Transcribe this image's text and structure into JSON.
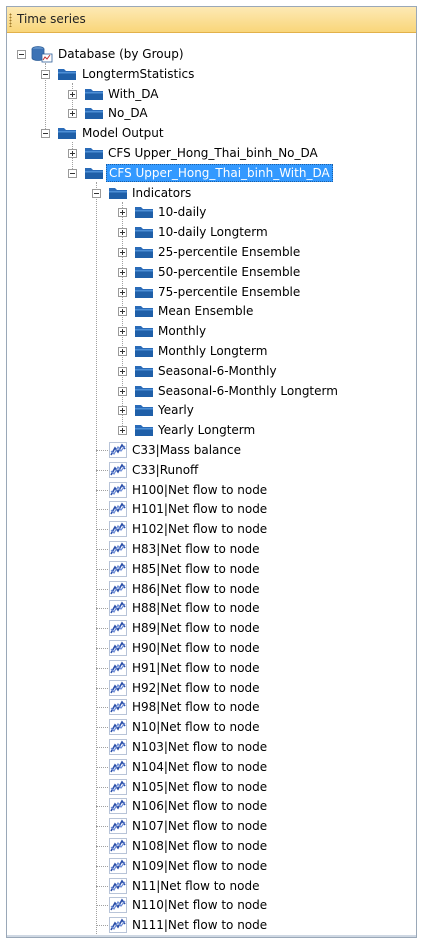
{
  "panel": {
    "title": "Time series"
  },
  "tree": {
    "root": {
      "label": "Database (by Group)"
    },
    "longterm": {
      "label": "LongtermStatistics",
      "children": [
        "With_DA",
        "No_DA"
      ]
    },
    "model_output": {
      "label": "Model Output"
    },
    "cfs_no_da": {
      "label": "CFS Upper_Hong_Thai_binh_No_DA"
    },
    "cfs_with_da": {
      "label": "CFS Upper_Hong_Thai_binh_With_DA",
      "selected": true
    },
    "indicators": {
      "label": "Indicators",
      "children": [
        "10-daily",
        "10-daily Longterm",
        "25-percentile Ensemble",
        "50-percentile Ensemble",
        "75-percentile Ensemble",
        "Mean Ensemble",
        "Monthly",
        "Monthly Longterm",
        "Seasonal-6-Monthly",
        "Seasonal-6-Monthly Longterm",
        "Yearly",
        "Yearly Longterm"
      ]
    },
    "series": [
      "C33|Mass balance",
      "C33|Runoff",
      "H100|Net flow to node",
      "H101|Net flow to node",
      "H102|Net flow to node",
      "H83|Net flow to node",
      "H85|Net flow to node",
      "H86|Net flow to node",
      "H88|Net flow to node",
      "H89|Net flow to node",
      "H90|Net flow to node",
      "H91|Net flow to node",
      "H92|Net flow to node",
      "H98|Net flow to node",
      "N10|Net flow to node",
      "N103|Net flow to node",
      "N104|Net flow to node",
      "N105|Net flow to node",
      "N106|Net flow to node",
      "N107|Net flow to node",
      "N108|Net flow to node",
      "N109|Net flow to node",
      "N11|Net flow to node",
      "N110|Net flow to node",
      "N111|Net flow to node"
    ]
  },
  "icons": {
    "folder": "folder-icon",
    "database": "database-icon",
    "series": "time-series-icon"
  },
  "colors": {
    "folder": "#1f5fa8",
    "selection": "#3399ff",
    "title_bar": "#f9d67a",
    "series_icon": "#2b4fa8"
  }
}
